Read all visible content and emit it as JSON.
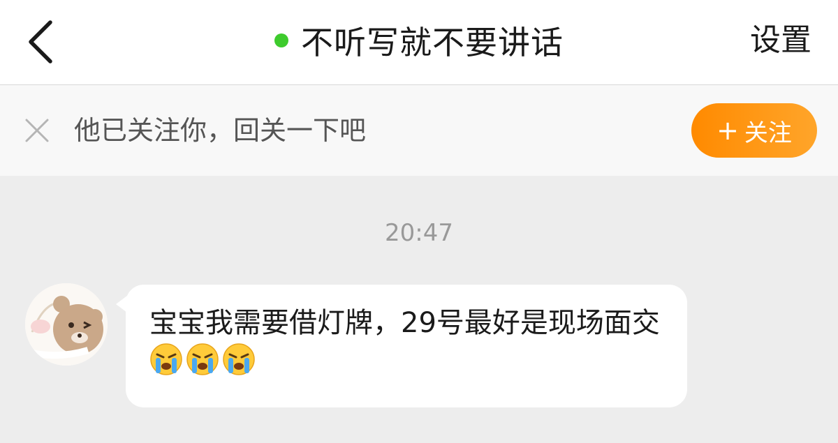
{
  "header": {
    "back_icon": "chevron-left-icon",
    "title": "不听写就不要讲话",
    "online_color": "#3ecb2d",
    "settings_label": "设置"
  },
  "follow_bar": {
    "close_icon": "close-icon",
    "text": "他已关注你，回关一下吧",
    "button_plus": "+",
    "button_label": "关注",
    "accent_color": "#ff9500"
  },
  "chat": {
    "timestamp": "20:47",
    "messages": [
      {
        "sender": "other",
        "avatar_icon": "bear-avatar",
        "text": "宝宝我需要借灯牌，29号最好是现场面交",
        "emojis": [
          "crying-face-emoji",
          "crying-face-emoji",
          "crying-face-emoji"
        ]
      }
    ]
  }
}
